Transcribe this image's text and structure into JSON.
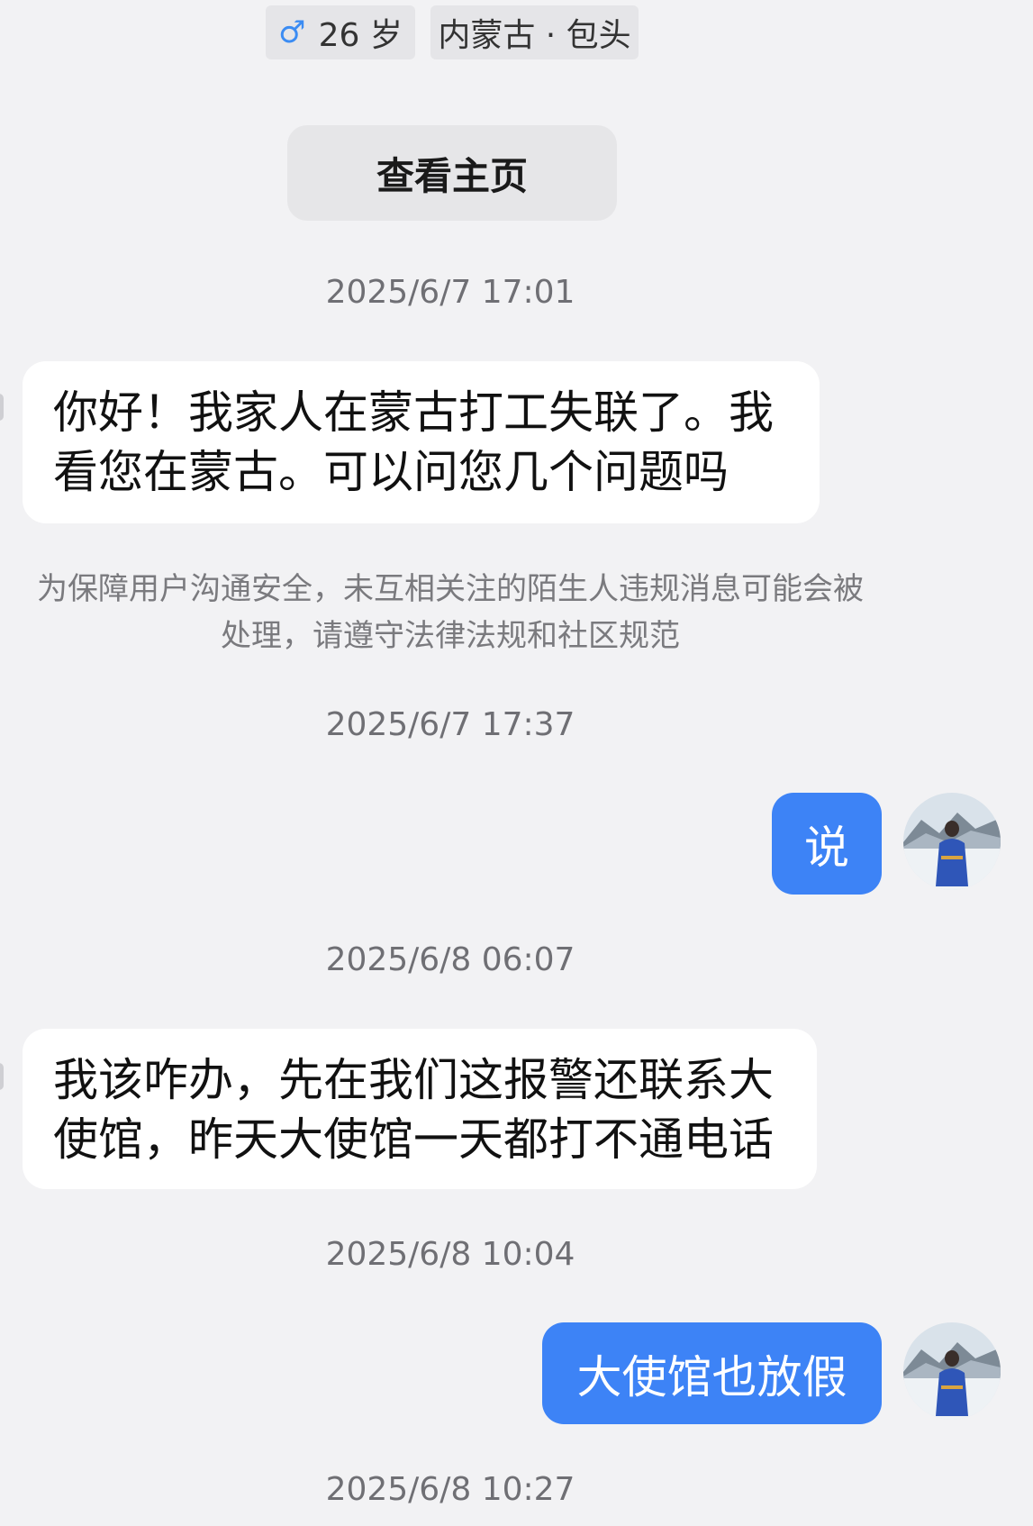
{
  "profile": {
    "gender_icon": "male-icon",
    "age": "26 岁",
    "location": "内蒙古 · 包头",
    "view_homepage_label": "查看主页"
  },
  "messages": [
    {
      "timestamp": "2025/6/7 17:01",
      "direction": "incoming",
      "lines": [
        "你好！我家人在蒙古打工失联了。我",
        "看您在蒙古。可以问您几个问题吗"
      ]
    },
    {
      "timestamp": "2025/6/7 17:37",
      "direction": "outgoing",
      "text": "说"
    },
    {
      "timestamp": "2025/6/8 06:07",
      "direction": "incoming",
      "lines": [
        "我该咋办，先在我们这报警还联系大",
        "使馆，昨天大使馆一天都打不通电话"
      ]
    },
    {
      "timestamp": "2025/6/8 10:04",
      "direction": "outgoing",
      "text": "大使馆也放假"
    },
    {
      "timestamp": "2025/6/8 10:27"
    }
  ],
  "notice": {
    "lines": [
      "为保障用户沟通安全，未互相关注的陌生人违规消息可能会被",
      "处理，请遵守法律法规和社区规范"
    ]
  },
  "colors": {
    "background": "#f2f2f4",
    "outgoing_bubble": "#3d83f6",
    "incoming_bubble": "#ffffff",
    "male_icon": "#3b8cf3"
  }
}
